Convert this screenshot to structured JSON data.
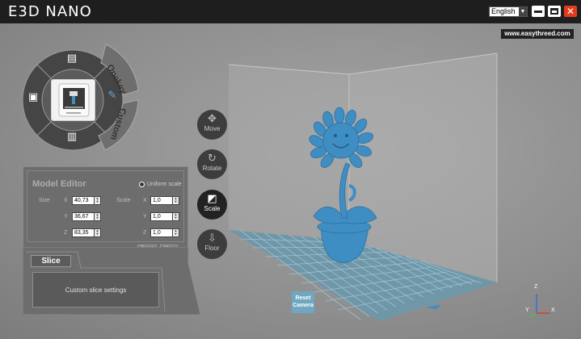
{
  "app": {
    "title": "E3D NANO"
  },
  "window": {
    "language": "English",
    "close_glyph": "✕"
  },
  "viewport": {
    "website": "www.easythreed.com",
    "reset_camera_label": "Reset Camera",
    "axes": {
      "z": "Z",
      "y": "Y",
      "x": "X"
    }
  },
  "tools": [
    {
      "label": "Move",
      "icon": "move-icon",
      "glyph": "✥"
    },
    {
      "label": "Rotate",
      "icon": "rotate-icon",
      "glyph": "↻"
    },
    {
      "label": "Scale",
      "icon": "scale-icon",
      "glyph": "◩"
    },
    {
      "label": "Floor",
      "icon": "floor-icon",
      "glyph": "⇩"
    }
  ],
  "wheel": {
    "onekey_label": "Onekey",
    "custom_label": "Custom",
    "icons": [
      "file-icon",
      "save-icon",
      "delete-icon",
      "pen-icon"
    ]
  },
  "model_editor": {
    "title": "Model Editor",
    "uniform_scale": "Uniform scale",
    "size_label": "Size",
    "scale_label": "Scale",
    "size": {
      "x": "40,73",
      "y": "36,67",
      "z": "83,35"
    },
    "scale": {
      "x": "1,0",
      "y": "1,0",
      "z": "1,0"
    },
    "axis_labels": {
      "x": "X",
      "y": "Y",
      "z": "Z"
    },
    "reset_label": "Reset",
    "max_label": "Max"
  },
  "slice": {
    "tab_label": "Slice",
    "custom_settings_label": "Custom slice settings"
  },
  "colors": {
    "titlebar": "#1e1e1e",
    "model": "#3e8ec4",
    "grid": "#7fb5cc",
    "close": "#e23b1c"
  }
}
